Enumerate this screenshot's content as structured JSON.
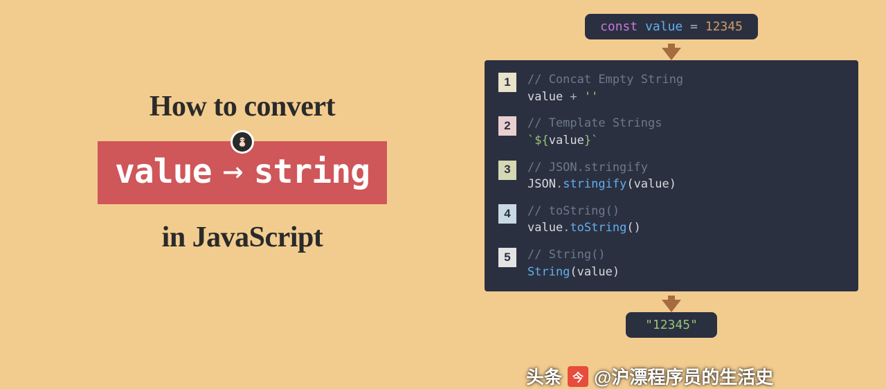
{
  "title": {
    "line1": "How to convert",
    "value_word": "value",
    "string_word": "string",
    "line3": "in JavaScript"
  },
  "input_code": {
    "const": "const",
    "var": "value",
    "eq": "=",
    "num": "12345"
  },
  "methods": [
    {
      "n": "1",
      "comment": "// Concat Empty String",
      "tokens": [
        "value",
        " + ",
        "''"
      ],
      "classes": [
        "ident",
        "op",
        "str"
      ]
    },
    {
      "n": "2",
      "comment": "// Template Strings",
      "tokens": [
        "`${",
        "value",
        "}`"
      ],
      "classes": [
        "str",
        "ident",
        "str"
      ]
    },
    {
      "n": "3",
      "comment": "// JSON.stringify",
      "tokens": [
        "JSON",
        ".",
        "stringify",
        "(value)"
      ],
      "classes": [
        "ident",
        "op",
        "func",
        "ident"
      ]
    },
    {
      "n": "4",
      "comment": "// toString()",
      "tokens": [
        "value",
        ".",
        "toString",
        "()"
      ],
      "classes": [
        "ident",
        "op",
        "func",
        "ident"
      ]
    },
    {
      "n": "5",
      "comment": "// String()",
      "tokens": [
        "String",
        "(value)"
      ],
      "classes": [
        "func",
        "ident"
      ]
    }
  ],
  "result": "\"12345\"",
  "watermark": {
    "label": "头条",
    "handle": "@沪漂程序员的生活史"
  },
  "chart_data": {
    "type": "table",
    "title": "How to convert value → string in JavaScript",
    "input": "const value = 12345",
    "output": "\"12345\"",
    "rows": [
      {
        "index": 1,
        "name": "Concat Empty String",
        "code": "value + ''"
      },
      {
        "index": 2,
        "name": "Template Strings",
        "code": "`${value}`"
      },
      {
        "index": 3,
        "name": "JSON.stringify",
        "code": "JSON.stringify(value)"
      },
      {
        "index": 4,
        "name": "toString()",
        "code": "value.toString()"
      },
      {
        "index": 5,
        "name": "String()",
        "code": "String(value)"
      }
    ]
  }
}
